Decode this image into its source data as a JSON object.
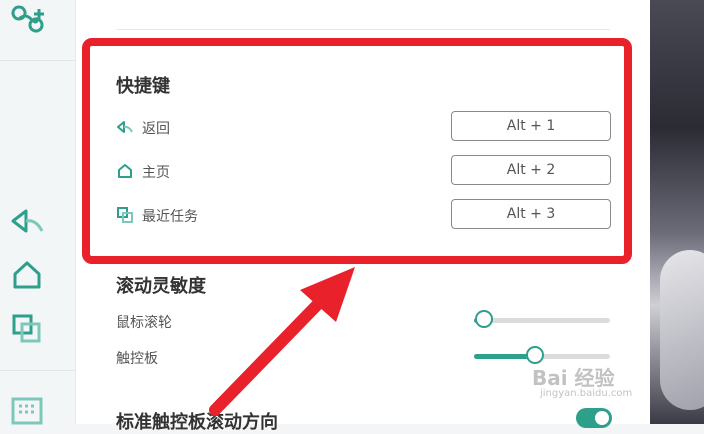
{
  "sidebar": {
    "logo_icon": "arduino-logo-icon",
    "icons": [
      "back-arrow-icon",
      "home-icon",
      "recent-tasks-icon",
      "keyboard-icon"
    ],
    "accent": "#2e9f8b"
  },
  "shortcuts": {
    "title": "快捷键",
    "items": [
      {
        "icon": "back-icon",
        "label": "返回",
        "key": "Alt + 1"
      },
      {
        "icon": "home-icon",
        "label": "主页",
        "key": "Alt + 2"
      },
      {
        "icon": "recent-tasks-icon",
        "label": "最近任务",
        "key": "Alt + 3"
      }
    ]
  },
  "sensitivity": {
    "title": "滚动灵敏度",
    "mouse_wheel": {
      "label": "鼠标滚轮",
      "value": 0.07
    },
    "touchpad": {
      "label": "触控板",
      "value": 0.45
    }
  },
  "scroll_direction": {
    "title": "标准触控板滚动方向",
    "enabled": true
  },
  "watermark": {
    "text": "Bai 经验",
    "sub": "jingyan.baidu.com"
  },
  "highlight_color": "#e8212a"
}
